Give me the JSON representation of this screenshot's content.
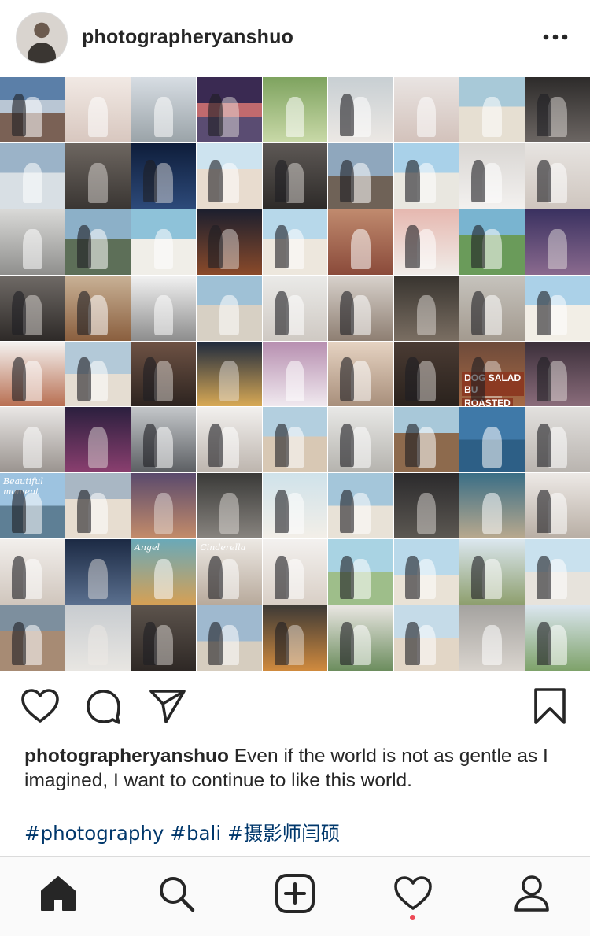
{
  "post": {
    "username": "photographeryanshuo",
    "caption_username": "photographeryanshuo",
    "caption_text": " Even if the world is not as gentle as I imagined, I want to continue to like this world.",
    "hashtags": [
      "#photography",
      "#bali",
      "#摄影师闫硕"
    ]
  },
  "collage": {
    "overlay_texts": {
      "beautiful": "Beautiful moment",
      "angel": "Angel",
      "cinderella": "Cinderella",
      "dog_salad": "DOG SALAD BU",
      "roasted": "ROASTED"
    },
    "tiles": [
      {
        "bg": "linear-gradient(180deg,#5b7fa8 0 35%,#b9c6d4 35% 55%,#7a6155 55% 100%)",
        "cls": "couple"
      },
      {
        "bg": "linear-gradient(180deg,#f1e9e4,#d8c7bf)",
        "cls": ""
      },
      {
        "bg": "linear-gradient(180deg,#d7dde3,#9aa3a8)",
        "cls": ""
      },
      {
        "bg": "linear-gradient(180deg,#3a2a52 0 40%,#c06a6e 40% 60%,#5a4c72 60% 100%)",
        "cls": "dark couple"
      },
      {
        "bg": "linear-gradient(180deg,#7ea35f,#c9d9a8)",
        "cls": ""
      },
      {
        "bg": "linear-gradient(180deg,#c8cfd3,#ece8e4)",
        "cls": "couple"
      },
      {
        "bg": "linear-gradient(180deg,#e9e4e2,#d3c2bb)",
        "cls": ""
      },
      {
        "bg": "linear-gradient(180deg,#a8c9d8 0 45%,#e6dfd2 45% 100%)",
        "cls": ""
      },
      {
        "bg": "linear-gradient(180deg,#2d2b2a,#6c6663)",
        "cls": "dark couple"
      },
      {
        "bg": "linear-gradient(180deg,#9bb3c8 0 45%,#d8dfe4 45% 100%)",
        "cls": ""
      },
      {
        "bg": "linear-gradient(180deg,#6d6660,#3a3633)",
        "cls": "dark"
      },
      {
        "bg": "linear-gradient(180deg,#0e1d3a,#2d4a7a)",
        "cls": "dark couple"
      },
      {
        "bg": "linear-gradient(180deg,#cde3ef 0 40%,#e8dccf 40% 100%)",
        "cls": "couple"
      },
      {
        "bg": "linear-gradient(180deg,#5d5855,#2e2b29)",
        "cls": "dark couple"
      },
      {
        "bg": "linear-gradient(180deg,#8fa7bd 0 50%,#6f6257 50% 100%)",
        "cls": "couple"
      },
      {
        "bg": "linear-gradient(180deg,#a9d1e9 0 45%,#e9e7e0 45% 100%)",
        "cls": "couple"
      },
      {
        "bg": "linear-gradient(180deg,#d9d6d3,#f3f1ef)",
        "cls": "couple"
      },
      {
        "bg": "linear-gradient(180deg,#e7e4e1,#cfc6bf)",
        "cls": "couple"
      },
      {
        "bg": "linear-gradient(180deg,#d9d9d7,#8f8f8d)",
        "cls": ""
      },
      {
        "bg": "linear-gradient(180deg,#8cb0c8 0 45%,#5d6f58 45% 100%)",
        "cls": "couple"
      },
      {
        "bg": "linear-gradient(180deg,#8ec2d9 0 45%,#f0eee8 45% 100%)",
        "cls": ""
      },
      {
        "bg": "linear-gradient(180deg,#1c1f2e,#8a4a2a)",
        "cls": "dark couple"
      },
      {
        "bg": "linear-gradient(180deg,#b7d8ea 0 45%,#ede7dd 45% 100%)",
        "cls": "couple"
      },
      {
        "bg": "linear-gradient(180deg,#c08a6e,#8a4a3a)",
        "cls": ""
      },
      {
        "bg": "linear-gradient(180deg,#e6b8b0,#f0ece8)",
        "cls": "couple"
      },
      {
        "bg": "linear-gradient(180deg,#79b4d0 0 40%,#6a9b5a 40% 100%)",
        "cls": "couple"
      },
      {
        "bg": "linear-gradient(180deg,#3a3160,#8a6a8e)",
        "cls": "dark"
      },
      {
        "bg": "linear-gradient(180deg,#6f6a66,#2e2a28)",
        "cls": "dark couple"
      },
      {
        "bg": "linear-gradient(180deg,#c9b296,#8a5f3e)",
        "cls": "couple"
      },
      {
        "bg": "linear-gradient(180deg,#f2f2f2,#8d8d8d)",
        "cls": ""
      },
      {
        "bg": "linear-gradient(180deg,#9fc1d6 0 45%,#d7d0c4 45% 100%)",
        "cls": ""
      },
      {
        "bg": "linear-gradient(180deg,#eaeae8,#cfc9c3)",
        "cls": "couple"
      },
      {
        "bg": "linear-gradient(180deg,#d8d2cc,#8e7f72)",
        "cls": "couple"
      },
      {
        "bg": "linear-gradient(180deg,#38342f,#7a6e62)",
        "cls": "dark"
      },
      {
        "bg": "linear-gradient(180deg,#c6c3bd,#a39a8f)",
        "cls": "couple"
      },
      {
        "bg": "linear-gradient(180deg,#abd1e8 0 45%,#f2eee6 45% 100%)",
        "cls": "couple"
      },
      {
        "bg": "linear-gradient(180deg,#f5f3f1,#b86f52)",
        "cls": "couple"
      },
      {
        "bg": "linear-gradient(180deg,#b3c9d8 0 50%,#e5ddd2 50% 100%)",
        "cls": "couple"
      },
      {
        "bg": "linear-gradient(180deg,#6e5244,#2d2420)",
        "cls": "dark couple"
      },
      {
        "bg": "linear-gradient(180deg,#1f2a3d,#d8a955)",
        "cls": "dark"
      },
      {
        "bg": "linear-gradient(180deg,#b78fb0,#f0e9ef)",
        "cls": ""
      },
      {
        "bg": "linear-gradient(180deg,#e6d3c2,#a88f7b)",
        "cls": "couple"
      },
      {
        "bg": "linear-gradient(180deg,#4a3b33,#2a221d)",
        "cls": "dark couple"
      },
      {
        "bg": "linear-gradient(180deg,#6d4a3a,#a76a45)",
        "cls": "dark couple"
      },
      {
        "bg": "linear-gradient(180deg,#3b2f3a,#8a6c7b)",
        "cls": "dark couple"
      },
      {
        "bg": "linear-gradient(180deg,#e9e7e5,#9a948f)",
        "cls": ""
      },
      {
        "bg": "linear-gradient(180deg,#2b1f3e,#8a3f6f)",
        "cls": "dark"
      },
      {
        "bg": "linear-gradient(180deg,#c4c7ca,#5c5f63)",
        "cls": "couple"
      },
      {
        "bg": "linear-gradient(180deg,#f2f0ee,#bdb5ae)",
        "cls": "couple"
      },
      {
        "bg": "linear-gradient(180deg,#b3cfdf 0 45%,#d8c8b4 45% 100%)",
        "cls": "couple"
      },
      {
        "bg": "linear-gradient(180deg,#e8e8e6,#b5b3ae)",
        "cls": "couple"
      },
      {
        "bg": "linear-gradient(180deg,#a8c8d9 0 40%,#8d6a4d 40% 100%)",
        "cls": "couple"
      },
      {
        "bg": "linear-gradient(180deg,#3f79a8 0 50%,#2d5f86 50% 100%)",
        "cls": ""
      },
      {
        "bg": "linear-gradient(180deg,#e2e0de,#b9b4af)",
        "cls": "couple"
      },
      {
        "bg": "linear-gradient(180deg,#9dc3e0 0 50%,#5e7f95 50% 100%)",
        "cls": "couple"
      },
      {
        "bg": "linear-gradient(180deg,#a9b7c4 0 40%,#e7ddd0 40% 100%)",
        "cls": "couple"
      },
      {
        "bg": "linear-gradient(180deg,#5a4a6d,#c48c6a)",
        "cls": "dark"
      },
      {
        "bg": "linear-gradient(180deg,#3a3a38,#88847f)",
        "cls": "dark"
      },
      {
        "bg": "linear-gradient(180deg,#cfe2ea,#f3efe8)",
        "cls": "couple"
      },
      {
        "bg": "linear-gradient(180deg,#a4c6da 0 50%,#e8e2d7 50% 100%)",
        "cls": "couple"
      },
      {
        "bg": "linear-gradient(180deg,#2b2a2c,#5c5852)",
        "cls": "dark"
      },
      {
        "bg": "linear-gradient(180deg,#3a6e86,#b9a98e)",
        "cls": ""
      },
      {
        "bg": "linear-gradient(180deg,#ede9e6,#b8aea4)",
        "cls": "couple"
      },
      {
        "bg": "linear-gradient(180deg,#f2efec,#d0c6bd)",
        "cls": "couple"
      },
      {
        "bg": "linear-gradient(180deg,#1c2a44,#5a6f8e)",
        "cls": "dark"
      },
      {
        "bg": "linear-gradient(180deg,#6aa9b8,#d5a055)",
        "cls": ""
      },
      {
        "bg": "linear-gradient(180deg,#ece8e3,#b8aa9c)",
        "cls": "couple"
      },
      {
        "bg": "linear-gradient(180deg,#f3f1ef,#d9cfc6)",
        "cls": "couple"
      },
      {
        "bg": "linear-gradient(180deg,#a9d3e3 0 50%,#9ebe8a 50% 100%)",
        "cls": "couple"
      },
      {
        "bg": "linear-gradient(180deg,#b9d9ea 0 55%,#e9e2d6 55% 100%)",
        "cls": "couple"
      },
      {
        "bg": "linear-gradient(180deg,#dbe7ef,#8e9f6e)",
        "cls": "couple"
      },
      {
        "bg": "linear-gradient(180deg,#c9e1ee 0 50%,#e7e3dc 50% 100%)",
        "cls": "couple"
      },
      {
        "bg": "linear-gradient(180deg,#7d8f9e 0 40%,#a78b74 40% 100%)",
        "cls": "couple"
      },
      {
        "bg": "linear-gradient(180deg,#c8ccd0,#e8e6e2)",
        "cls": "dark"
      },
      {
        "bg": "linear-gradient(180deg,#5c534c,#2e2825)",
        "cls": "dark couple"
      },
      {
        "bg": "linear-gradient(180deg,#9fb9cf 0 55%,#d6cdbf 55% 100%)",
        "cls": "couple"
      },
      {
        "bg": "linear-gradient(180deg,#3e3a36,#d08a3e)",
        "cls": "dark couple"
      },
      {
        "bg": "linear-gradient(180deg,#e9e6e2,#6c8d5e)",
        "cls": "couple"
      },
      {
        "bg": "linear-gradient(180deg,#c5dbe8 0 50%,#e2d6c6 50% 100%)",
        "cls": "couple"
      },
      {
        "bg": "linear-gradient(180deg,#a5a3a0,#d9d4ce)",
        "cls": ""
      },
      {
        "bg": "linear-gradient(180deg,#dbe6ef,#7ea26a)",
        "cls": "couple"
      }
    ]
  },
  "colors": {
    "text": "#262626",
    "hashtag": "#00376b",
    "border": "#dbdbdb",
    "notification_dot": "#ed4956"
  },
  "icons": {
    "more": "more-dots-icon",
    "like": "heart-icon",
    "comment": "comment-icon",
    "share": "send-icon",
    "save": "bookmark-icon",
    "nav": [
      "home-icon",
      "search-icon",
      "add-post-icon",
      "activity-heart-icon",
      "profile-icon"
    ]
  }
}
